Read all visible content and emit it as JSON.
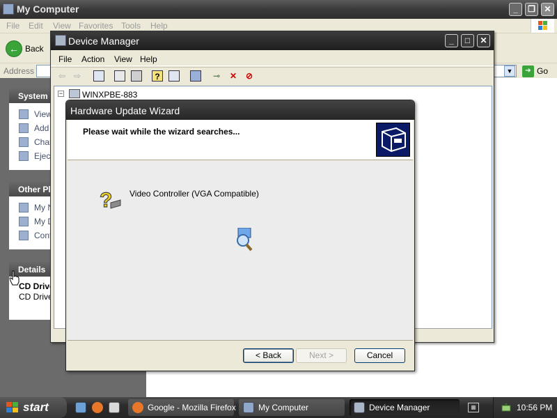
{
  "my_computer": {
    "title": "My Computer",
    "menu": [
      "File",
      "Edit",
      "View",
      "Favorites",
      "Tools",
      "Help"
    ],
    "back_label": "Back",
    "address_label": "Address",
    "go_label": "Go",
    "panels": {
      "system": {
        "header": "System",
        "items": [
          "View",
          "Add",
          "Char",
          "Eject"
        ]
      },
      "other": {
        "header": "Other Pl",
        "items": [
          "My N",
          "My D",
          "Cont"
        ]
      },
      "details": {
        "header": "Details",
        "name": "CD Drive",
        "type": "CD Drive"
      }
    }
  },
  "device_manager": {
    "title": "Device Manager",
    "menu": [
      "File",
      "Action",
      "View",
      "Help"
    ],
    "tree_root": "WINXPBE-883",
    "tree_toggle": "−"
  },
  "wizard": {
    "title": "Hardware Update Wizard",
    "header_text": "Please wait while the wizard searches...",
    "device_name": "Video Controller (VGA Compatible)",
    "back_button": "< Back",
    "next_button": "Next >",
    "cancel_button": "Cancel"
  },
  "taskbar": {
    "start_label": "start",
    "tasks": [
      "Google - Mozilla Firefox",
      "My Computer",
      "Device Manager"
    ],
    "active_task": "Device Manager",
    "clock": "10:56 PM"
  },
  "window_buttons": {
    "minimize": "_",
    "maximize": "□",
    "close": "✕",
    "restore": "❐"
  }
}
